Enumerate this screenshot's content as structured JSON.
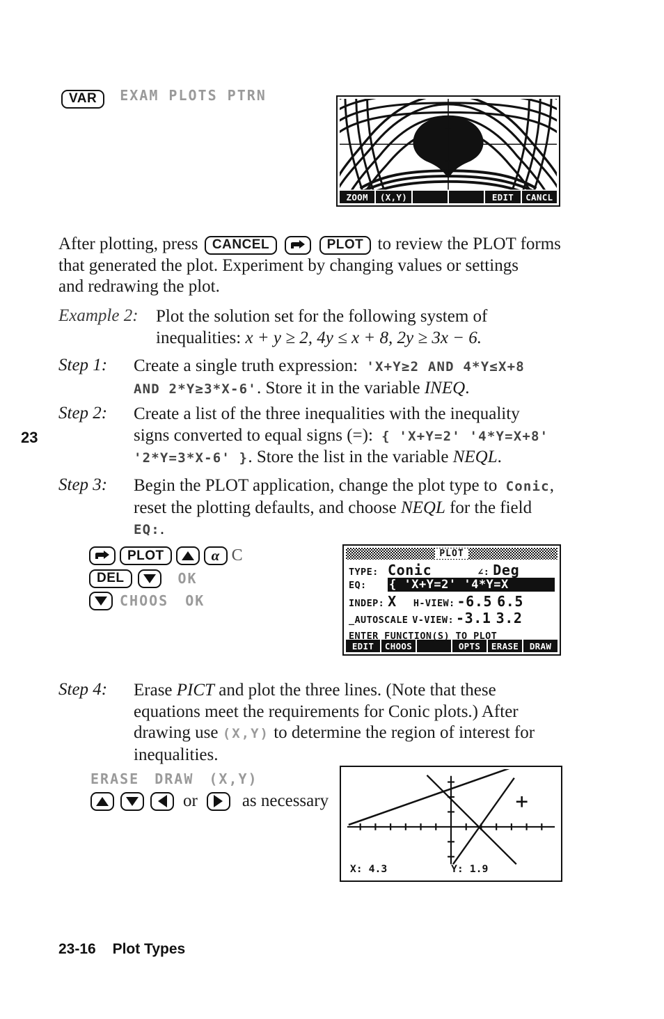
{
  "page": {
    "chapter_marker": "23",
    "footer_page": "23-16",
    "footer_title": "Plot Types"
  },
  "top_keys": {
    "var_key": "VAR",
    "menu_labels": "EXAM PLOTS PTRN"
  },
  "pattern_screen": {
    "softkeys": [
      "ZOOM",
      "(X,Y)",
      "",
      "",
      "EDIT",
      "CANCL"
    ]
  },
  "paragraph1": {
    "part1": "After plotting, press",
    "key_cancel": "CANCEL",
    "key_rightshift": "→",
    "key_plot": "PLOT",
    "part2": "to review the PLOT forms",
    "line2": "that generated the plot. Experiment by changing values or settings",
    "line3": "and redrawing the plot."
  },
  "example": {
    "label": "Example 2:",
    "line1": "Plot the solution set for the following system of",
    "line2_prefix": "inequalities:",
    "line2_math": "x + y ≥ 2, 4y ≤ x + 8, 2y ≥ 3x − 6."
  },
  "step1": {
    "label": "Step 1:",
    "line1_text": "Create a single truth expression:",
    "line1_code": "'X+Y≥2 AND 4*Y≤X+8",
    "line2_code": "AND 2*Y≥3*X-6'",
    "line2_text": ". Store it in the variable",
    "line2_var": "INEQ",
    "line2_end": "."
  },
  "step2": {
    "label": "Step 2:",
    "line1": "Create a list of the three inequalities with the inequality",
    "line2_text": "signs converted to equal signs (=):",
    "line2_code": "{ 'X+Y=2' '4*Y=X+8'",
    "line3_code": "'2*Y=3*X-6' }",
    "line3_text": ". Store the list in the variable",
    "line3_var": "NEQL",
    "line3_end": "."
  },
  "step3": {
    "label": "Step 3:",
    "line1_text": "Begin the PLOT application, change the plot type to",
    "line1_code": "Conic",
    "line1_end": ",",
    "line2_a": "reset the plotting defaults, and choose",
    "line2_var": "NEQL",
    "line2_b": "for the field",
    "line3_code": "EQ:",
    "line3_end": "."
  },
  "keystrokes_step3": {
    "row1": {
      "key_rightshift": "→",
      "key_plot": "PLOT",
      "key_up": "up-triangle",
      "key_alpha": "α",
      "letter": "C"
    },
    "row2": {
      "key_del": "DEL",
      "key_down": "down-triangle",
      "softkey_ok": "OK"
    },
    "row3": {
      "key_down": "down-triangle",
      "softkey_choos": "CHOOS",
      "softkey_ok": "OK"
    }
  },
  "plot_form": {
    "title": "PLOT",
    "type_label": "TYPE:",
    "type_value": "Conic",
    "angle_label": "∠:",
    "angle_value": "Deg",
    "eq_label": "EQ:",
    "eq_value": "{ 'X+Y=2'  '4*Y=X",
    "indep_label": "INDEP:",
    "indep_value": "X",
    "hview_label": "H-VIEW:",
    "hview_min": "-6.5",
    "hview_max": "6.5",
    "autoscale_label": "_AUTOSCALE",
    "vview_label": "V-VIEW:",
    "vview_min": "-3.1",
    "vview_max": "3.2",
    "prompt": "ENTER FUNCTION(S) TO PLOT",
    "softkeys": [
      "EDIT",
      "CHOOS",
      "",
      "OPTS",
      "ERASE",
      "DRAW"
    ]
  },
  "step4": {
    "label": "Step 4:",
    "line1_a": "Erase",
    "line1_var": "PICT",
    "line1_b": "and plot the three lines. (Note that these",
    "line2": "equations meet the requirements for Conic plots.) After",
    "line3_a": "drawing use",
    "line3_code": "(X,Y)",
    "line3_b": "to determine the region of interest for",
    "line4": "inequalities."
  },
  "keystrokes_step4": {
    "softkeys": [
      "ERASE",
      "DRAW",
      "(X,Y)"
    ],
    "key_up": "up-triangle",
    "key_down": "down-triangle",
    "key_left": "left-triangle",
    "or_text": "or",
    "key_right": "right-triangle",
    "trailing_text": "as necessary"
  },
  "result_screen": {
    "x_label": "X: 4.3",
    "y_label": "Y: 1.9",
    "cursor_marker": "+"
  },
  "chart_data": {
    "type": "line",
    "title": "Conic plot of three lines",
    "xlabel": "X",
    "ylabel": "Y",
    "xlim": [
      -6.5,
      6.5
    ],
    "ylim": [
      -3.1,
      3.2
    ],
    "grid": false,
    "legend": "none",
    "cursor": {
      "x": 4.3,
      "y": 1.9
    },
    "series": [
      {
        "name": "X+Y=2",
        "equation": "x + y = 2",
        "slope": -1,
        "intercept": 2
      },
      {
        "name": "4*Y=X+8",
        "equation": "4y = x + 8",
        "slope": 0.25,
        "intercept": 2
      },
      {
        "name": "2*Y=3*X-6",
        "equation": "2y = 3x - 6",
        "slope": 1.5,
        "intercept": -3
      }
    ]
  }
}
